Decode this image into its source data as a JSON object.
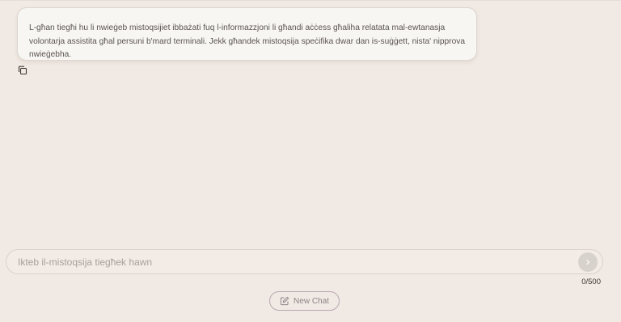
{
  "conversation": {
    "messages": [
      {
        "role": "assistant",
        "text": "L-għan tiegħi hu li nwieġeb mistoqsijiet ibbażati fuq l-informazzjoni li għandi aċċess għaliha relatata mal-ewtanasja volontarja assistita għal persuni b'mard terminali. Jekk għandek mistoqsija speċifika dwar dan is-suġġett, nista' nipprova nwieġebha."
      }
    ],
    "copy_icon": "copy-icon"
  },
  "composer": {
    "placeholder": "Ikteb il-mistoqsija tiegħek hawn",
    "value": "",
    "send_icon": "chevron-right-icon",
    "char_count": "0/500"
  },
  "new_chat": {
    "label": "New Chat",
    "icon": "pencil-square-icon"
  },
  "colors": {
    "background": "#f1e9e3",
    "bubble": "#f8f6f3",
    "new_chat_border": "#b9a7b3"
  }
}
